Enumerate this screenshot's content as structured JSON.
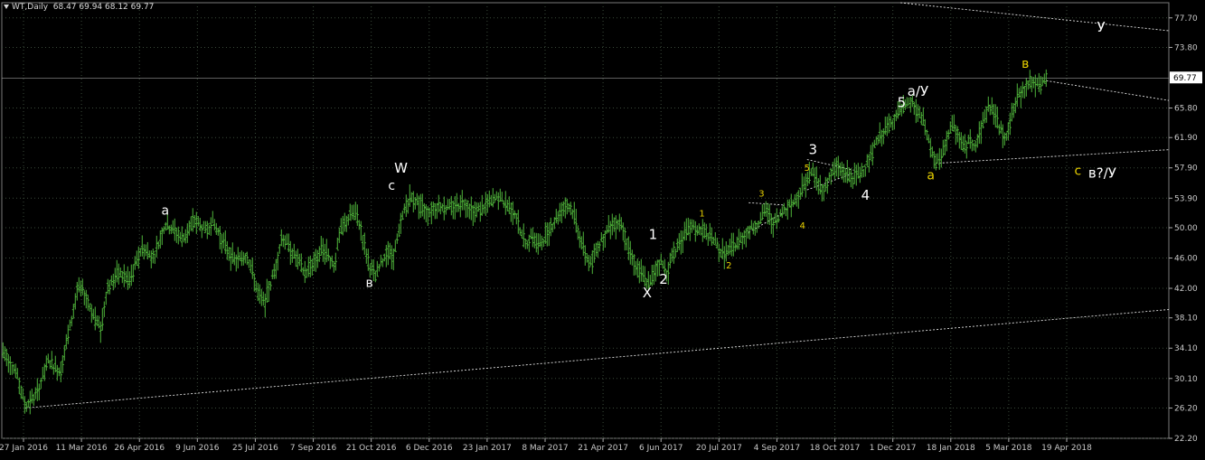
{
  "header": {
    "symbol": "WT,Daily",
    "ohlc": "68.47 69.94 68.12 69.77"
  },
  "colors": {
    "background": "#000000",
    "grid": "#3a4a3a",
    "candle": "#4fb33a",
    "axis_text": "#c8c8c8",
    "label_white": "#ffffff",
    "label_yellow": "#e8d000",
    "trendline": "#e0e0e0"
  },
  "chart_data": {
    "type": "candlestick",
    "title": "WT,Daily",
    "ylim": [
      22.2,
      79.7
    ],
    "grid": true,
    "y_ticks": [
      "77.70",
      "73.80",
      "69.77",
      "65.80",
      "61.90",
      "57.90",
      "53.90",
      "50.00",
      "46.00",
      "42.00",
      "38.10",
      "34.10",
      "30.10",
      "26.20",
      "22.20"
    ],
    "x_ticks": [
      "27 Jan 2016",
      "11 Mar 2016",
      "26 Apr 2016",
      "9 Jun 2016",
      "25 Jul 2016",
      "7 Sep 2016",
      "21 Oct 2016",
      "6 Dec 2016",
      "23 Jan 2017",
      "8 Mar 2017",
      "21 Apr 2017",
      "6 Jun 2017",
      "20 Jul 2017",
      "4 Sep 2017",
      "18 Oct 2017",
      "1 Dec 2017",
      "18 Jan 2018",
      "5 Mar 2018",
      "19 Apr 2018"
    ],
    "price_marker": "69.77",
    "price_path": [
      [
        0,
        34.0
      ],
      [
        0.012,
        31.0
      ],
      [
        0.02,
        26.5
      ],
      [
        0.03,
        28.0
      ],
      [
        0.04,
        32.5
      ],
      [
        0.05,
        31.0
      ],
      [
        0.06,
        38.0
      ],
      [
        0.065,
        42.0
      ],
      [
        0.07,
        41.5
      ],
      [
        0.08,
        38.0
      ],
      [
        0.085,
        36.5
      ],
      [
        0.09,
        42.0
      ],
      [
        0.1,
        44.0
      ],
      [
        0.11,
        43.0
      ],
      [
        0.12,
        47.5
      ],
      [
        0.13,
        46.0
      ],
      [
        0.14,
        50.5
      ],
      [
        0.145,
        50.0
      ],
      [
        0.155,
        48.5
      ],
      [
        0.165,
        51.0
      ],
      [
        0.175,
        49.5
      ],
      [
        0.18,
        51.0
      ],
      [
        0.19,
        48.0
      ],
      [
        0.2,
        45.5
      ],
      [
        0.21,
        46.5
      ],
      [
        0.215,
        44.0
      ],
      [
        0.22,
        41.0
      ],
      [
        0.225,
        40.0
      ],
      [
        0.235,
        45.0
      ],
      [
        0.24,
        49.0
      ],
      [
        0.25,
        46.5
      ],
      [
        0.26,
        44.0
      ],
      [
        0.27,
        46.0
      ],
      [
        0.275,
        47.5
      ],
      [
        0.285,
        45.0
      ],
      [
        0.29,
        49.5
      ],
      [
        0.3,
        52.0
      ],
      [
        0.305,
        51.5
      ],
      [
        0.31,
        48.0
      ],
      [
        0.315,
        45.0
      ],
      [
        0.32,
        43.5
      ],
      [
        0.33,
        47.0
      ],
      [
        0.335,
        46.0
      ],
      [
        0.34,
        49.0
      ],
      [
        0.345,
        52.5
      ],
      [
        0.35,
        54.0
      ],
      [
        0.355,
        53.5
      ],
      [
        0.365,
        52.0
      ],
      [
        0.375,
        53.0
      ],
      [
        0.385,
        52.5
      ],
      [
        0.395,
        53.5
      ],
      [
        0.405,
        52.0
      ],
      [
        0.415,
        53.0
      ],
      [
        0.425,
        54.0
      ],
      [
        0.43,
        53.5
      ],
      [
        0.44,
        52.0
      ],
      [
        0.445,
        49.0
      ],
      [
        0.45,
        48.0
      ],
      [
        0.455,
        49.0
      ],
      [
        0.46,
        47.5
      ],
      [
        0.47,
        50.0
      ],
      [
        0.48,
        52.5
      ],
      [
        0.485,
        53.0
      ],
      [
        0.49,
        52.0
      ],
      [
        0.495,
        49.0
      ],
      [
        0.5,
        46.5
      ],
      [
        0.505,
        45.0
      ],
      [
        0.51,
        47.5
      ],
      [
        0.515,
        48.5
      ],
      [
        0.52,
        50.0
      ],
      [
        0.53,
        51.0
      ],
      [
        0.535,
        48.5
      ],
      [
        0.54,
        46.0
      ],
      [
        0.545,
        44.5
      ],
      [
        0.55,
        43.5
      ],
      [
        0.555,
        42.5
      ],
      [
        0.56,
        44.5
      ],
      [
        0.565,
        45.5
      ],
      [
        0.57,
        44.0
      ],
      [
        0.575,
        46.5
      ],
      [
        0.58,
        48.0
      ],
      [
        0.59,
        50.0
      ],
      [
        0.6,
        49.5
      ],
      [
        0.61,
        48.5
      ],
      [
        0.615,
        47.0
      ],
      [
        0.62,
        46.5
      ],
      [
        0.63,
        48.0
      ],
      [
        0.64,
        49.5
      ],
      [
        0.65,
        51.0
      ],
      [
        0.655,
        52.5
      ],
      [
        0.66,
        50.5
      ],
      [
        0.665,
        51.0
      ],
      [
        0.67,
        52.5
      ],
      [
        0.68,
        53.5
      ],
      [
        0.685,
        55.0
      ],
      [
        0.69,
        56.5
      ],
      [
        0.695,
        57.5
      ],
      [
        0.7,
        55.5
      ],
      [
        0.705,
        55.0
      ],
      [
        0.71,
        57.0
      ],
      [
        0.715,
        58.0
      ],
      [
        0.72,
        57.5
      ],
      [
        0.73,
        56.5
      ],
      [
        0.74,
        58.0
      ],
      [
        0.745,
        59.5
      ],
      [
        0.75,
        61.5
      ],
      [
        0.755,
        62.5
      ],
      [
        0.76,
        63.5
      ],
      [
        0.765,
        64.5
      ],
      [
        0.77,
        65.5
      ],
      [
        0.775,
        66.0
      ],
      [
        0.78,
        66.5
      ],
      [
        0.785,
        65.0
      ],
      [
        0.79,
        64.0
      ],
      [
        0.795,
        61.0
      ],
      [
        0.8,
        58.5
      ],
      [
        0.805,
        59.0
      ],
      [
        0.81,
        62.0
      ],
      [
        0.815,
        63.5
      ],
      [
        0.82,
        62.0
      ],
      [
        0.825,
        60.5
      ],
      [
        0.83,
        61.5
      ],
      [
        0.835,
        61.0
      ],
      [
        0.84,
        63.5
      ],
      [
        0.845,
        66.0
      ],
      [
        0.85,
        65.5
      ],
      [
        0.855,
        63.0
      ],
      [
        0.86,
        62.0
      ],
      [
        0.865,
        64.5
      ],
      [
        0.87,
        67.0
      ],
      [
        0.875,
        68.0
      ],
      [
        0.88,
        69.5
      ],
      [
        0.885,
        69.0
      ],
      [
        0.89,
        68.5
      ],
      [
        0.895,
        69.77
      ]
    ],
    "trendlines": [
      {
        "from": [
          0.02,
          26.2
        ],
        "to": [
          1.0,
          39.2
        ]
      },
      {
        "from": [
          0.77,
          79.7
        ],
        "to": [
          1.0,
          76.0
        ]
      },
      {
        "from": [
          0.895,
          69.4
        ],
        "to": [
          1.0,
          66.8
        ]
      },
      {
        "from": [
          0.8,
          58.5
        ],
        "to": [
          1.0,
          60.3
        ]
      },
      {
        "from": [
          0.69,
          55.0
        ],
        "to": [
          0.73,
          57.2
        ]
      },
      {
        "from": [
          0.69,
          59.0
        ],
        "to": [
          0.73,
          57.6
        ]
      },
      {
        "from": [
          0.64,
          49.4
        ],
        "to": [
          0.67,
          52.0
        ]
      },
      {
        "from": [
          0.64,
          53.3
        ],
        "to": [
          0.67,
          53.0
        ]
      }
    ],
    "annotations": [
      {
        "text": "a",
        "x": 0.14,
        "y": 51.7,
        "color": "white",
        "size": "large"
      },
      {
        "text": "в",
        "x": 0.315,
        "y": 42.2,
        "color": "white",
        "size": "large"
      },
      {
        "text": "c",
        "x": 0.334,
        "y": 55.0,
        "color": "white",
        "size": "large"
      },
      {
        "text": "W",
        "x": 0.342,
        "y": 57.3,
        "color": "white",
        "size": "xlarge"
      },
      {
        "text": "1",
        "x": 0.558,
        "y": 48.5,
        "color": "white",
        "size": "xlarge"
      },
      {
        "text": "2",
        "x": 0.567,
        "y": 42.6,
        "color": "white",
        "size": "xlarge"
      },
      {
        "text": "X",
        "x": 0.553,
        "y": 40.8,
        "color": "white",
        "size": "xlarge"
      },
      {
        "text": "1",
        "x": 0.6,
        "y": 51.5,
        "color": "yellow",
        "size": "small"
      },
      {
        "text": "2",
        "x": 0.623,
        "y": 44.6,
        "color": "yellow",
        "size": "small"
      },
      {
        "text": "3",
        "x": 0.651,
        "y": 54.1,
        "color": "yellow",
        "size": "small"
      },
      {
        "text": "4",
        "x": 0.686,
        "y": 49.9,
        "color": "yellow",
        "size": "small"
      },
      {
        "text": "3",
        "x": 0.695,
        "y": 59.7,
        "color": "white",
        "size": "xlarge"
      },
      {
        "text": "5",
        "x": 0.69,
        "y": 57.5,
        "color": "yellow",
        "size": "small"
      },
      {
        "text": "4",
        "x": 0.74,
        "y": 53.7,
        "color": "white",
        "size": "xlarge"
      },
      {
        "text": "5",
        "x": 0.771,
        "y": 65.9,
        "color": "white",
        "size": "xlarge"
      },
      {
        "text": "a/У",
        "x": 0.785,
        "y": 67.4,
        "color": "white",
        "size": "xlarge"
      },
      {
        "text": "a",
        "x": 0.796,
        "y": 56.4,
        "color": "yellow",
        "size": "large"
      },
      {
        "text": "в",
        "x": 0.877,
        "y": 71.1,
        "color": "yellow",
        "size": "large"
      },
      {
        "text": "с",
        "x": 0.922,
        "y": 57.0,
        "color": "yellow",
        "size": "large"
      },
      {
        "text": "в?/У",
        "x": 0.943,
        "y": 56.6,
        "color": "white",
        "size": "xlarge"
      },
      {
        "text": "У",
        "x": 0.942,
        "y": 75.9,
        "color": "white",
        "size": "xlarge"
      }
    ]
  }
}
